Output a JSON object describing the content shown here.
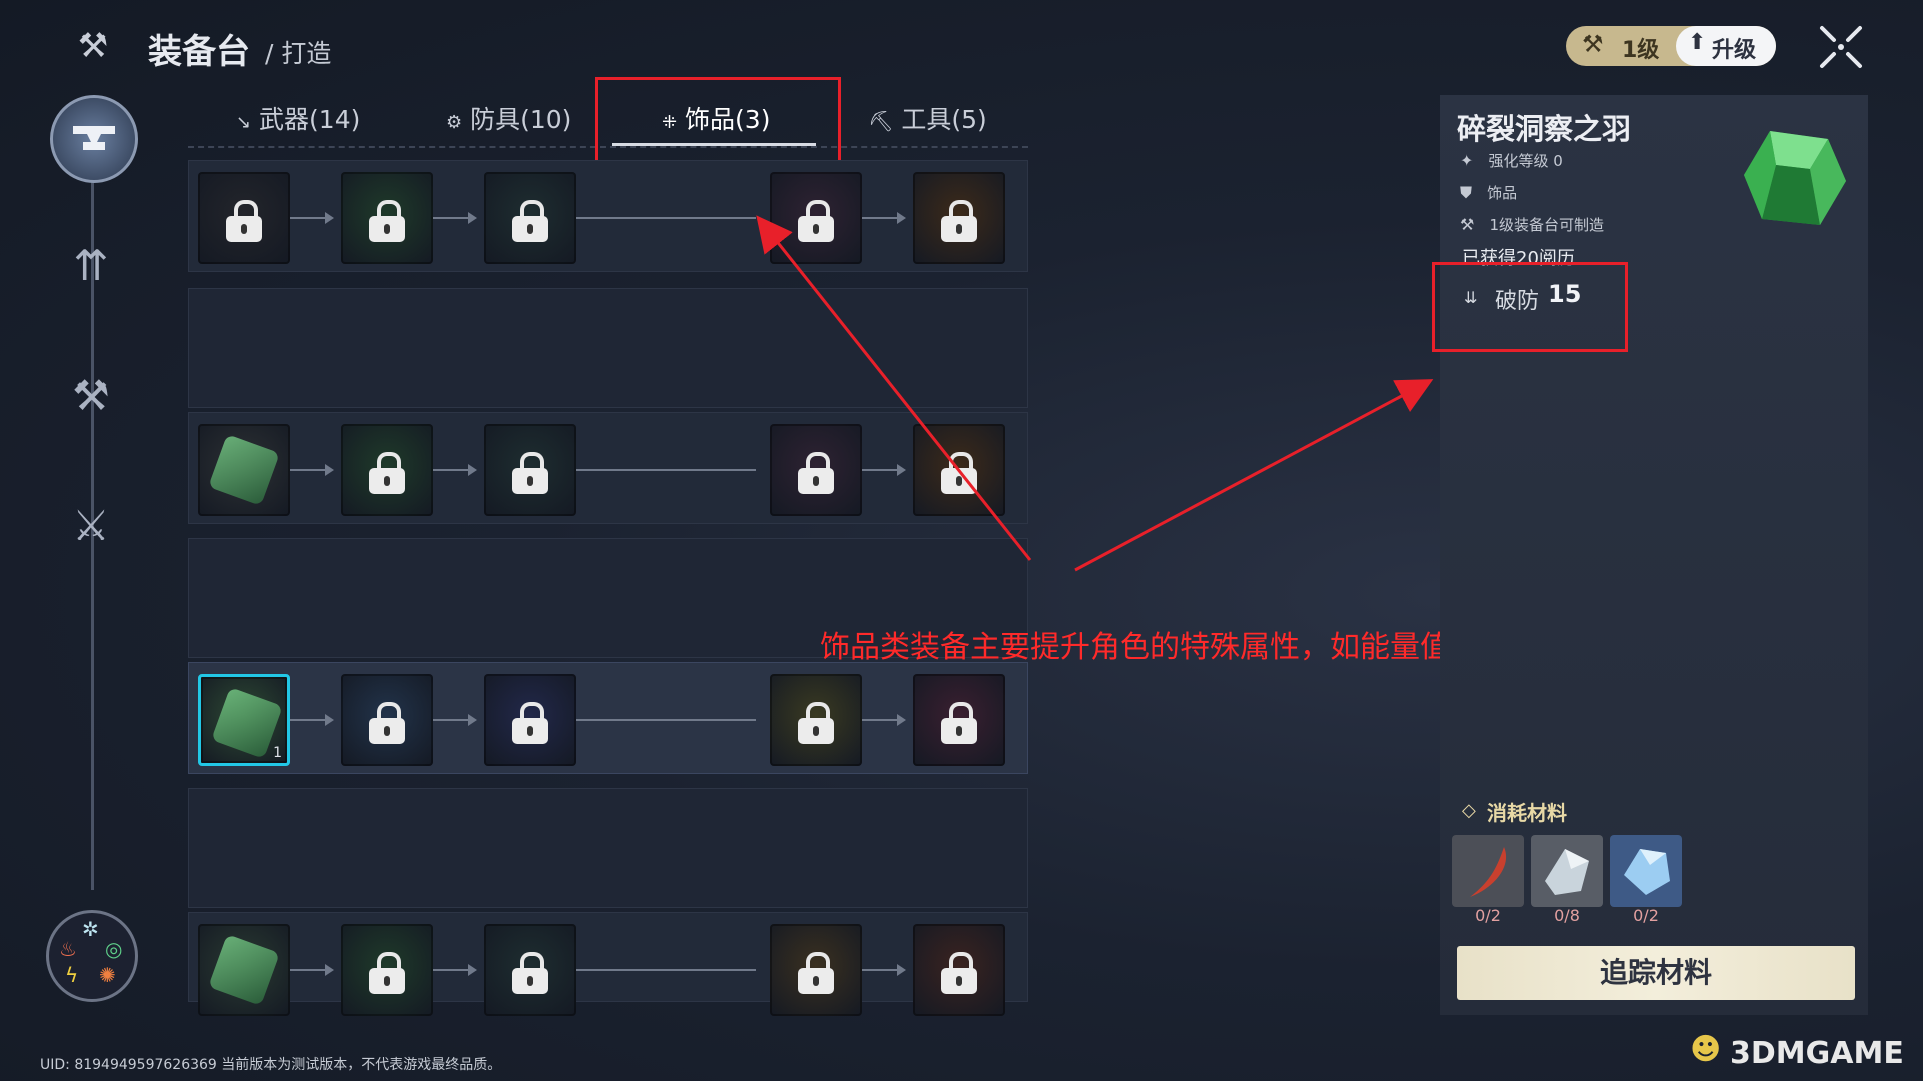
{
  "header": {
    "title": "装备台",
    "subtitle": "/ 打造",
    "icon": "anvil-icon"
  },
  "level": {
    "label": "1级",
    "upgrade_label": "升级"
  },
  "tabs": [
    {
      "label": "武器(14)",
      "icon": "sword-icon"
    },
    {
      "label": "防具(10)",
      "icon": "armor-icon"
    },
    {
      "label": "饰品(3)",
      "icon": "accessory-icon",
      "active": true
    },
    {
      "label": "工具(5)",
      "icon": "pickaxe-icon"
    }
  ],
  "tree": {
    "rows": [
      {
        "colors": [
          "#23252b",
          "#1f3a2a",
          "#1e2d30",
          "#2e2232",
          "#3c2a1a"
        ],
        "locked": [
          true,
          true,
          true,
          true,
          true
        ],
        "selected": false
      },
      {
        "colors": [
          "#2d3134",
          "#1f3a2a",
          "#1e2d30",
          "#2e2232",
          "#3c2a1a"
        ],
        "locked": [
          false,
          true,
          true,
          true,
          true
        ],
        "selected": false
      },
      {
        "colors": [
          "#2e4a34",
          "#22334a",
          "#22284a",
          "#3a3a22",
          "#3a1f30"
        ],
        "locked": [
          false,
          true,
          true,
          true,
          true
        ],
        "selected": true,
        "count": "1"
      },
      {
        "colors": [
          "#2a3a32",
          "#1f3a2a",
          "#1e2d30",
          "#3a3020",
          "#3a2320"
        ],
        "locked": [
          false,
          true,
          true,
          true,
          true
        ],
        "selected": false
      }
    ]
  },
  "detail": {
    "name": "碎裂洞察之羽",
    "attrs": [
      "强化等级 0",
      "饰品",
      "1级装备台可制造"
    ],
    "obtained": "已获得20阅历",
    "stat_label": "破防",
    "stat_value": "15"
  },
  "materials": {
    "title": "消耗材料",
    "items": [
      {
        "count": "0/2",
        "color": "#4c4f57"
      },
      {
        "count": "0/8",
        "color": "#585d66"
      },
      {
        "count": "0/2",
        "color": "#3e5a86"
      }
    ],
    "track_label": "追踪材料"
  },
  "annotation": "饰品类装备主要提升角色的特殊属性，如能量值、破甲、暴击率等",
  "footer": "UID: 8194949597626369 当前版本为测试版本，不代表游戏最终品质。",
  "watermark": "3DMGAME",
  "colors": {
    "highlight": "#22c7e6",
    "annotation": "#e8202a",
    "panel": "#2b3343"
  }
}
